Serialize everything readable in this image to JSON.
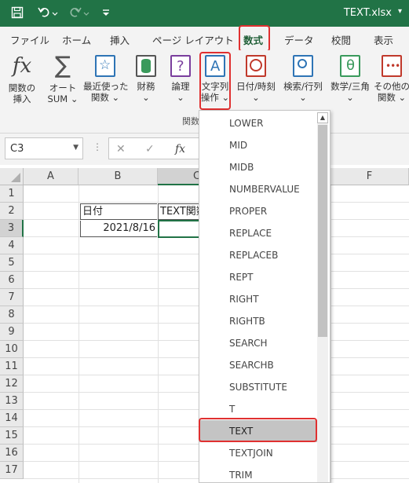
{
  "title_bar": {
    "file_name": "TEXT.xlsx"
  },
  "tabs": [
    "ファイル",
    "ホーム",
    "挿入",
    "ページ レイアウト",
    "数式",
    "データ",
    "校閲",
    "表示"
  ],
  "ribbon": {
    "buttons": [
      {
        "line1": "関数の",
        "line2": "挿入"
      },
      {
        "line1": "オート",
        "line2": "SUM ⌄"
      },
      {
        "line1": "最近使った",
        "line2": "関数 ⌄"
      },
      {
        "line1": "財務",
        "line2": "⌄"
      },
      {
        "line1": "論理",
        "line2": "⌄"
      },
      {
        "line1": "文字列",
        "line2": "操作 ⌄"
      },
      {
        "line1": "日付/時刻",
        "line2": "⌄"
      },
      {
        "line1": "検索/行列",
        "line2": "⌄"
      },
      {
        "line1": "数学/三角",
        "line2": "⌄"
      },
      {
        "line1": "その他の",
        "line2": "関数 ⌄"
      }
    ],
    "group_label": "関数"
  },
  "formula_bar": {
    "name_box": "C3",
    "fx": "fx"
  },
  "columns": [
    "A",
    "B",
    "C",
    "F"
  ],
  "rows": [
    "1",
    "2",
    "3",
    "4",
    "5",
    "6",
    "7",
    "8",
    "9",
    "10",
    "11",
    "12",
    "13",
    "14",
    "15",
    "16",
    "17"
  ],
  "cells": {
    "B2": "日付",
    "C2": "TEXT関数",
    "B3": "2021/8/16"
  },
  "dropdown": {
    "items": [
      "LOWER",
      "MID",
      "MIDB",
      "NUMBERVALUE",
      "PROPER",
      "REPLACE",
      "REPLACEB",
      "REPT",
      "RIGHT",
      "RIGHTB",
      "SEARCH",
      "SEARCHB",
      "SUBSTITUTE",
      "T",
      "TEXT",
      "TEXTJOIN",
      "TRIM"
    ],
    "highlighted": "TEXT"
  },
  "colors": {
    "excel_green": "#217346",
    "highlight_red": "#e03030",
    "selected_item": "#c4c4c4"
  }
}
